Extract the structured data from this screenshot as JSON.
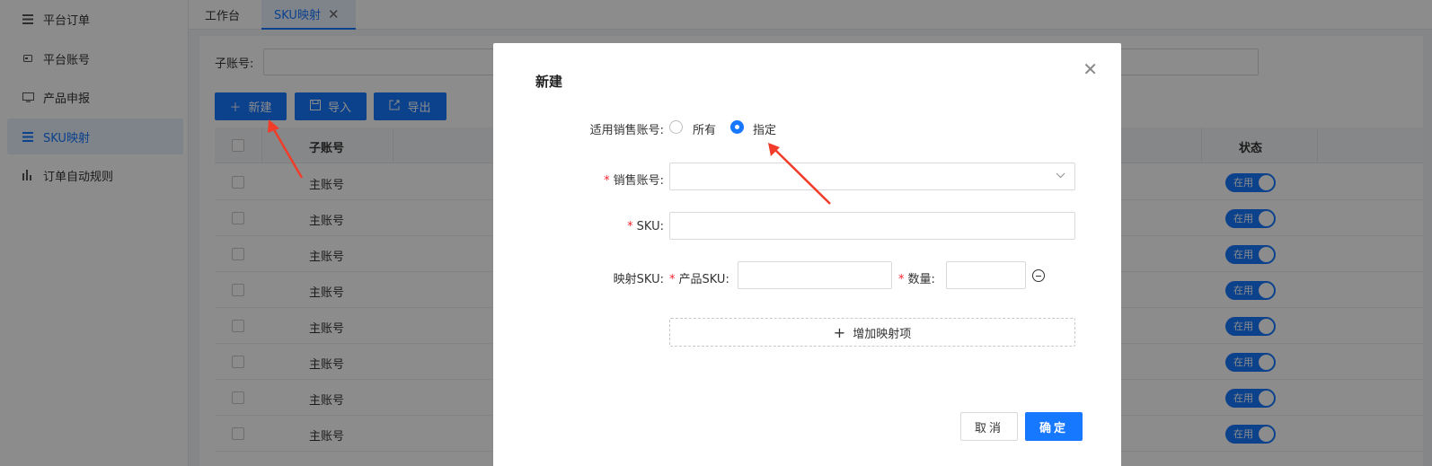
{
  "sidebar": {
    "items": [
      {
        "label": "平台订单",
        "icon": "list-icon"
      },
      {
        "label": "平台账号",
        "icon": "card-icon"
      },
      {
        "label": "产品申报",
        "icon": "monitor-icon"
      },
      {
        "label": "SKU映射",
        "icon": "list-icon",
        "active": true
      },
      {
        "label": "订单自动规则",
        "icon": "bar-chart-icon"
      }
    ]
  },
  "tabs": [
    {
      "label": "工作台"
    },
    {
      "label": "SKU映射",
      "active": true
    }
  ],
  "filter": {
    "sub_account_label": "子账号:"
  },
  "toolbar": {
    "new_label": "新建",
    "import_label": "导入",
    "export_label": "导出"
  },
  "table": {
    "headers": {
      "sub_account": "子账号",
      "status": "状态"
    },
    "rows": [
      {
        "sub_account": "主账号",
        "status": "在用"
      },
      {
        "sub_account": "主账号",
        "status": "在用"
      },
      {
        "sub_account": "主账号",
        "status": "在用"
      },
      {
        "sub_account": "主账号",
        "status": "在用"
      },
      {
        "sub_account": "主账号",
        "status": "在用"
      },
      {
        "sub_account": "主账号",
        "status": "在用"
      },
      {
        "sub_account": "主账号",
        "status": "在用"
      },
      {
        "sub_account": "主账号",
        "status": "在用"
      }
    ]
  },
  "modal": {
    "title": "新建",
    "applicable_label": "适用销售账号:",
    "radio_all": "所有",
    "radio_specified": "指定",
    "selected_radio": "指定",
    "sales_account_label": "销售账号:",
    "sales_account_value": "",
    "sku_label": "SKU:",
    "sku_value": "",
    "mapping_label": "映射SKU:",
    "product_sku_label": "产品SKU:",
    "product_sku_value": "",
    "quantity_label": "数量:",
    "quantity_value": "",
    "add_mapping_label": "增加映射项",
    "cancel_label": "取消",
    "ok_label": "确定",
    "required_mark": "*"
  },
  "colors": {
    "primary": "#1677ff",
    "required": "#f5222d",
    "arrow": "#f23c2a"
  }
}
